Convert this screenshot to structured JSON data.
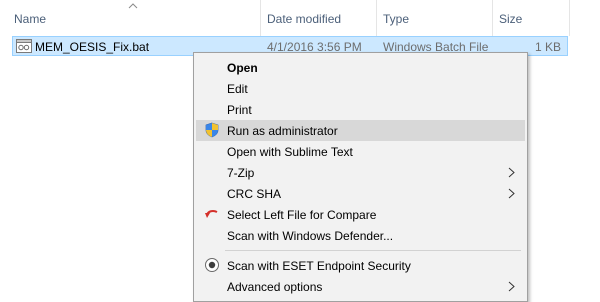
{
  "columns": {
    "name": "Name",
    "date_modified": "Date modified",
    "type": "Type",
    "size": "Size"
  },
  "sort_indicator": "sort-ascending-icon",
  "file": {
    "name": "MEM_OESIS_Fix.bat",
    "date_modified": "4/1/2016 3:56 PM",
    "type": "Windows Batch File",
    "size": "1 KB",
    "icon": "batch-file-icon"
  },
  "context_menu": {
    "items": [
      {
        "label": "Open"
      },
      {
        "label": "Edit"
      },
      {
        "label": "Print"
      },
      {
        "label": "Run as administrator",
        "icon": "uac-shield-icon"
      },
      {
        "label": "Open with Sublime Text"
      },
      {
        "label": "7-Zip",
        "submenu": true
      },
      {
        "label": "CRC SHA",
        "submenu": true
      },
      {
        "label": "Select Left File for Compare",
        "icon": "compare-arrow-icon"
      },
      {
        "label": "Scan with Windows Defender..."
      },
      {
        "label": "Scan with ESET Endpoint Security",
        "icon": "eset-icon"
      },
      {
        "label": "Advanced options",
        "submenu": true
      }
    ]
  },
  "colors": {
    "selection_bg": "#cce8ff",
    "selection_border": "#99d1ff",
    "header_text": "#4c607a",
    "menu_bg": "#f2f2f2",
    "menu_hover": "#d8d8d8"
  }
}
